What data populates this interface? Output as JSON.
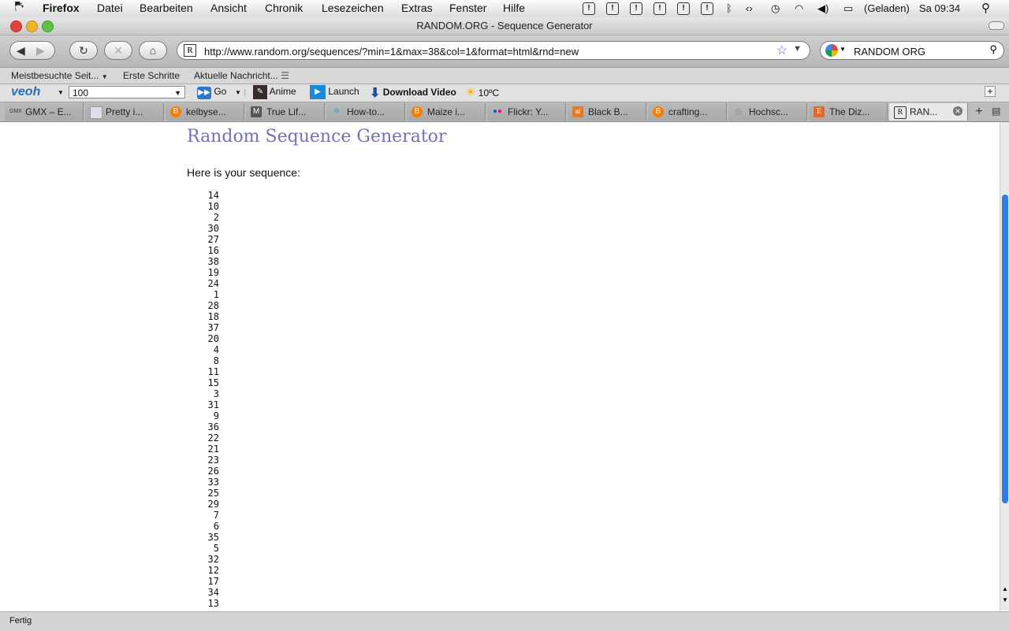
{
  "menubar": {
    "app": "Firefox",
    "menus": [
      "Datei",
      "Bearbeiten",
      "Ansicht",
      "Chronik",
      "Lesezeichen",
      "Extras",
      "Fenster",
      "Hilfe"
    ],
    "battery_text": "(Geladen)",
    "clock": "Sa 09:34"
  },
  "window": {
    "title": "RANDOM.ORG - Sequence Generator"
  },
  "navbar": {
    "url": "http://www.random.org/sequences/?min=1&max=38&col=1&format=html&rnd=new",
    "search_value": "RANDOM ORG"
  },
  "bookmarks": [
    "Meistbesuchte Seit...",
    "Erste Schritte",
    "Aktuelle Nachricht..."
  ],
  "toolbar": {
    "logo": "veoh",
    "zoom_value": "100",
    "go_label": "Go",
    "anime_label": "Anime",
    "launch_label": "Launch",
    "download_label": "Download Video",
    "weather": "10ºC"
  },
  "tabs": [
    {
      "icon": "GMX",
      "label": "GMX – E..."
    },
    {
      "icon": "",
      "label": "Pretty i..."
    },
    {
      "icon": "B",
      "label": "kelbyse..."
    },
    {
      "icon": "",
      "label": "True Lif..."
    },
    {
      "icon": "",
      "label": "How-to..."
    },
    {
      "icon": "B",
      "label": "Maize i..."
    },
    {
      "icon": "",
      "label": "Flickr: Y..."
    },
    {
      "icon": "af",
      "label": "Black B..."
    },
    {
      "icon": "B",
      "label": "crafting..."
    },
    {
      "icon": "",
      "label": "Hochsc..."
    },
    {
      "icon": "E",
      "label": "The Diz..."
    },
    {
      "icon": "R",
      "label": "RAN..."
    }
  ],
  "page": {
    "heading": "Random Sequence Generator",
    "intro": "Here is your sequence:",
    "sequence": [
      14,
      10,
      2,
      30,
      27,
      16,
      38,
      19,
      24,
      1,
      28,
      18,
      37,
      20,
      4,
      8,
      11,
      15,
      3,
      31,
      9,
      36,
      22,
      21,
      23,
      26,
      33,
      25,
      29,
      7,
      6,
      35,
      5,
      32,
      12,
      17,
      34,
      13
    ]
  },
  "status": {
    "text": "Fertig"
  },
  "colors": {
    "heading": "#6f6fc8",
    "scroll_thumb": "#2f7ee8"
  }
}
